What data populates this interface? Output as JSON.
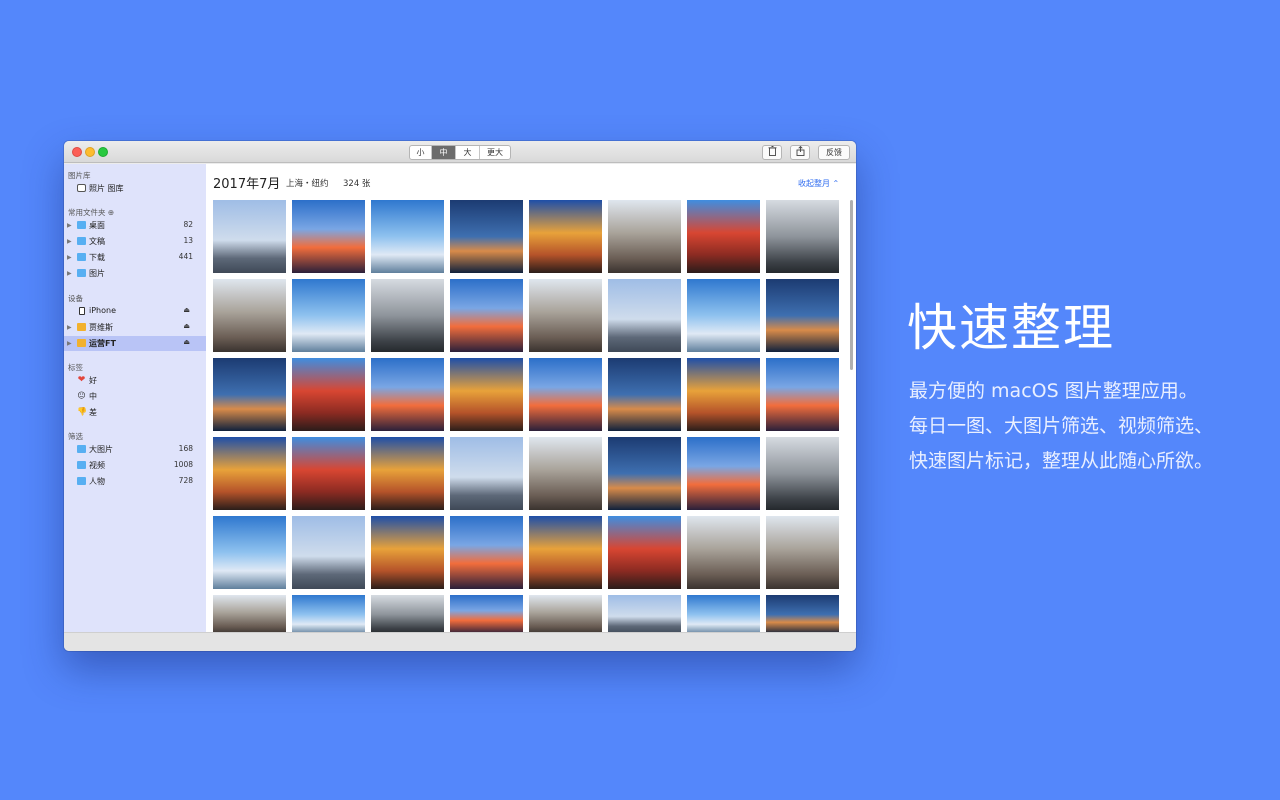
{
  "window": {
    "view_sizes": [
      {
        "label": "小",
        "active": false
      },
      {
        "label": "中",
        "active": true
      },
      {
        "label": "大",
        "active": false
      },
      {
        "label": "更大",
        "active": false
      }
    ],
    "trash_icon": "trash-icon",
    "share_icon": "share-icon",
    "feedback_label": "反馈"
  },
  "sidebar": {
    "library": {
      "title": "图片库",
      "items": [
        {
          "label": "照片 图库",
          "icon": "photos-icon"
        }
      ]
    },
    "folders": {
      "title": "常用文件夹",
      "items": [
        {
          "label": "桌面",
          "count": "82",
          "icon": "folder-icon"
        },
        {
          "label": "文稿",
          "count": "13",
          "icon": "folder-icon"
        },
        {
          "label": "下载",
          "count": "441",
          "icon": "folder-icon"
        },
        {
          "label": "图片",
          "count": "",
          "icon": "folder-icon"
        }
      ]
    },
    "devices": {
      "title": "设备",
      "items": [
        {
          "label": "iPhone",
          "icon": "iphone-icon",
          "selected": false
        },
        {
          "label": "贾维斯",
          "icon": "disk-icon",
          "selected": false
        },
        {
          "label": "运营FT",
          "icon": "disk-icon",
          "selected": true
        }
      ]
    },
    "tags": {
      "title": "标签",
      "items": [
        {
          "label": "好",
          "icon": "heart-icon",
          "glyph": "❤"
        },
        {
          "label": "中",
          "icon": "neutral-face-icon",
          "glyph": "😐"
        },
        {
          "label": "差",
          "icon": "thumbs-down-icon",
          "glyph": "👎"
        }
      ]
    },
    "filters": {
      "title": "筛选",
      "items": [
        {
          "label": "大图片",
          "count": "168",
          "icon": "folder-icon"
        },
        {
          "label": "视频",
          "count": "1008",
          "icon": "folder-icon"
        },
        {
          "label": "人物",
          "count": "728",
          "icon": "folder-icon"
        }
      ]
    }
  },
  "content": {
    "title": "2017年7月",
    "location": "上海・纽约",
    "count": "324 张",
    "collapse_label": "收起整月 ⌃"
  },
  "colors": {
    "background": "#5487fb",
    "sidebar": "#dfe3fb",
    "sidebar_selected": "#b9c4f6",
    "link": "#2f6cf0"
  },
  "promo": {
    "headline": "快速整理",
    "lines": [
      "最方便的 macOS 图片整理应用。",
      "每日一图、大图片筛选、视频筛选、",
      "快速图片标记，整理从此随心所欲。"
    ]
  }
}
